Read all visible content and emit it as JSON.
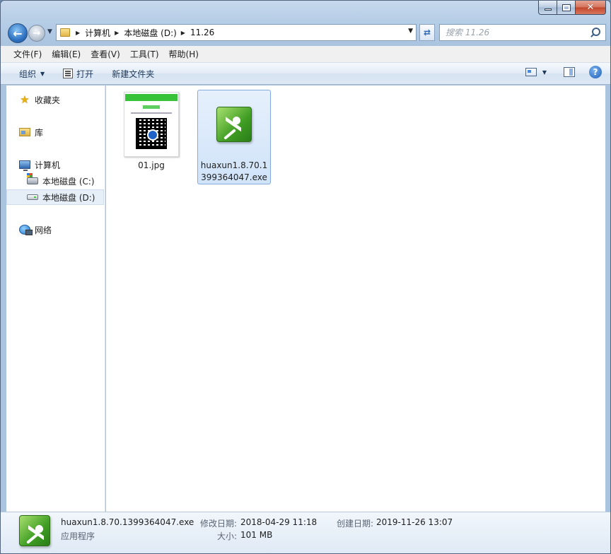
{
  "window": {
    "caption": {
      "close_glyph": "✕"
    }
  },
  "address": {
    "crumbs": [
      "计算机",
      "本地磁盘 (D:)",
      "11.26"
    ]
  },
  "search": {
    "placeholder": "搜索 11.26"
  },
  "menubar": {
    "items": [
      "文件(F)",
      "编辑(E)",
      "查看(V)",
      "工具(T)",
      "帮助(H)"
    ]
  },
  "toolbar": {
    "organize": "组织",
    "open": "打开",
    "new_folder": "新建文件夹"
  },
  "navpane": {
    "favorites": "收藏夹",
    "libraries": "库",
    "computer": "计算机",
    "drive_c": "本地磁盘 (C:)",
    "drive_d": "本地磁盘 (D:)",
    "network": "网络"
  },
  "files": [
    {
      "name": "01.jpg",
      "icon": "qr-thumbnail",
      "selected": false
    },
    {
      "name": "huaxun1.8.70.1399364047.exe",
      "icon": "huaxun-app-icon",
      "selected": true
    }
  ],
  "details": {
    "name": "huaxun1.8.70.1399364047.exe",
    "type": "应用程序",
    "modified_label": "修改日期:",
    "modified_value": "2018-04-29 11:18",
    "created_label": "创建日期:",
    "created_value": "2019-11-26 13:07",
    "size_label": "大小:",
    "size_value": "101 MB"
  },
  "colors": {
    "selection": "#d0e3f9",
    "selection_border": "#84acdd",
    "app_icon_green": "#3f9d23"
  }
}
